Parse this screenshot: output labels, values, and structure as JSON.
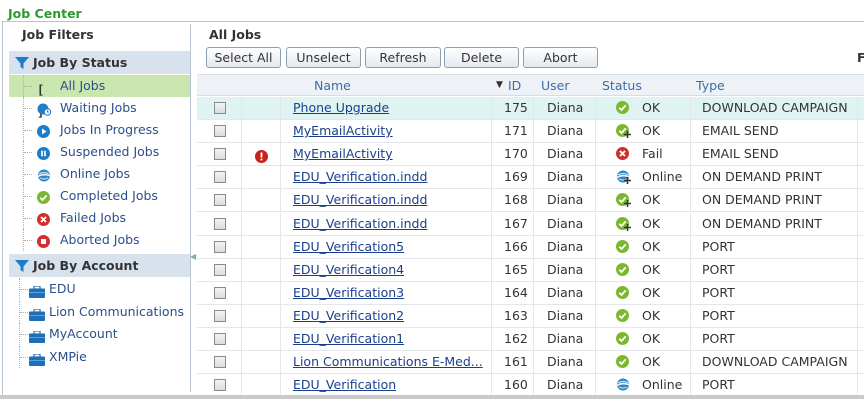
{
  "page_title": "Job Center",
  "sidebar": {
    "title": "Job Filters",
    "status_section": "Job By Status",
    "status_items": [
      {
        "label": "All Jobs",
        "icon": "brackets-icon"
      },
      {
        "label": "Waiting Jobs",
        "icon": "waiting-icon"
      },
      {
        "label": "Jobs In Progress",
        "icon": "play-icon"
      },
      {
        "label": "Suspended Jobs",
        "icon": "pause-icon"
      },
      {
        "label": "Online Jobs",
        "icon": "online-icon"
      },
      {
        "label": "Completed Jobs",
        "icon": "check-icon"
      },
      {
        "label": "Failed Jobs",
        "icon": "x-icon"
      },
      {
        "label": "Aborted Jobs",
        "icon": "stop-icon"
      }
    ],
    "account_section": "Job By Account",
    "account_items": [
      {
        "label": "EDU"
      },
      {
        "label": "Lion Communications"
      },
      {
        "label": "MyAccount"
      },
      {
        "label": "XMPie"
      }
    ]
  },
  "main": {
    "title": "All Jobs",
    "toolbar": {
      "select_all": "Select All",
      "unselect": "Unselect",
      "refresh": "Refresh",
      "delete": "Delete",
      "abort": "Abort"
    },
    "cut_letter": "F",
    "columns": {
      "name": "Name",
      "id": "ID",
      "user": "User",
      "status": "Status",
      "type": "Type"
    },
    "rows": [
      {
        "name": "Phone Upgrade",
        "id": "175",
        "user": "Diana",
        "status": "OK",
        "status_icon": "check",
        "type": "DOWNLOAD CAMPAIGN",
        "highlight": true,
        "warning": false
      },
      {
        "name": "MyEmailActivity",
        "id": "171",
        "user": "Diana",
        "status": "OK",
        "status_icon": "check-plus",
        "type": "EMAIL SEND",
        "highlight": false,
        "warning": false
      },
      {
        "name": "MyEmailActivity",
        "id": "170",
        "user": "Diana",
        "status": "Fail",
        "status_icon": "fail",
        "type": "EMAIL SEND",
        "highlight": false,
        "warning": true
      },
      {
        "name": "EDU_Verification.indd",
        "id": "169",
        "user": "Diana",
        "status": "Online",
        "status_icon": "online-plus",
        "type": "ON DEMAND PRINT",
        "highlight": false,
        "warning": false
      },
      {
        "name": "EDU_Verification.indd",
        "id": "168",
        "user": "Diana",
        "status": "OK",
        "status_icon": "check-plus",
        "type": "ON DEMAND PRINT",
        "highlight": false,
        "warning": false
      },
      {
        "name": "EDU_Verification.indd",
        "id": "167",
        "user": "Diana",
        "status": "OK",
        "status_icon": "check-plus",
        "type": "ON DEMAND PRINT",
        "highlight": false,
        "warning": false
      },
      {
        "name": "EDU_Verification5",
        "id": "166",
        "user": "Diana",
        "status": "OK",
        "status_icon": "check",
        "type": "PORT",
        "highlight": false,
        "warning": false
      },
      {
        "name": "EDU_Verification4",
        "id": "165",
        "user": "Diana",
        "status": "OK",
        "status_icon": "check",
        "type": "PORT",
        "highlight": false,
        "warning": false
      },
      {
        "name": "EDU_Verification3",
        "id": "164",
        "user": "Diana",
        "status": "OK",
        "status_icon": "check",
        "type": "PORT",
        "highlight": false,
        "warning": false
      },
      {
        "name": "EDU_Verification2",
        "id": "163",
        "user": "Diana",
        "status": "OK",
        "status_icon": "check",
        "type": "PORT",
        "highlight": false,
        "warning": false
      },
      {
        "name": "EDU_Verification1",
        "id": "162",
        "user": "Diana",
        "status": "OK",
        "status_icon": "check",
        "type": "PORT",
        "highlight": false,
        "warning": false
      },
      {
        "name": "Lion Communications E-Med...",
        "id": "161",
        "user": "Diana",
        "status": "OK",
        "status_icon": "check",
        "type": "DOWNLOAD CAMPAIGN",
        "highlight": false,
        "warning": false
      },
      {
        "name": "EDU_Verification",
        "id": "160",
        "user": "Diana",
        "status": "Online",
        "status_icon": "online",
        "type": "PORT",
        "highlight": false,
        "warning": false
      }
    ]
  },
  "colors": {
    "title_green": "#2e9a2e",
    "link_blue": "#1a3f8c",
    "ok_green": "#7cb82f",
    "fail_red": "#d0312d",
    "selected_bg": "#c8e6ad",
    "highlight_row": "#dff3f3"
  }
}
